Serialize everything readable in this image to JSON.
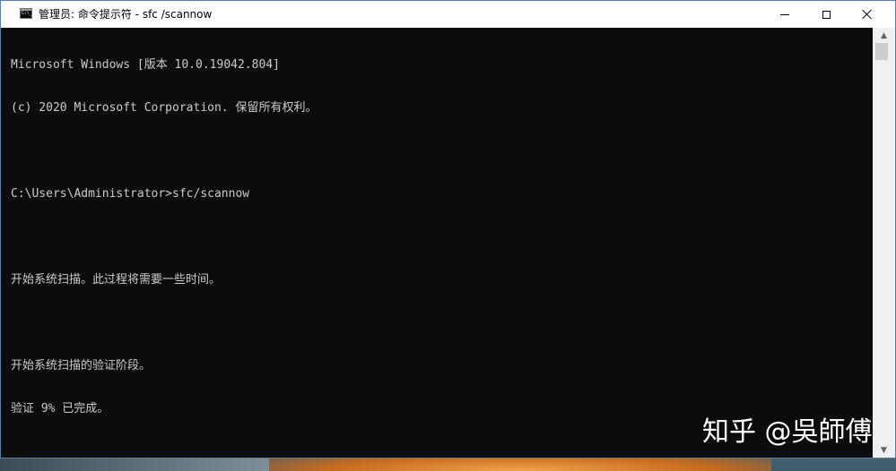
{
  "window": {
    "title": "管理员: 命令提示符 - sfc /scannow",
    "icon": "cmd-icon",
    "controls": {
      "minimize": "minimize-icon",
      "maximize": "maximize-icon",
      "close": "close-icon"
    }
  },
  "console": {
    "lines": [
      "Microsoft Windows [版本 10.0.19042.804]",
      "(c) 2020 Microsoft Corporation. 保留所有权利。",
      "",
      "C:\\Users\\Administrator>sfc/scannow",
      "",
      "开始系统扫描。此过程将需要一些时间。",
      "",
      "开始系统扫描的验证阶段。",
      "验证 9% 已完成。"
    ]
  },
  "scrollbar": {
    "up": "▲",
    "down": "▼"
  },
  "watermark": "知乎 @吳師傅",
  "colors": {
    "console_bg": "#0c0c0c",
    "console_text": "#cccccc",
    "titlebar_bg": "#ffffff"
  }
}
